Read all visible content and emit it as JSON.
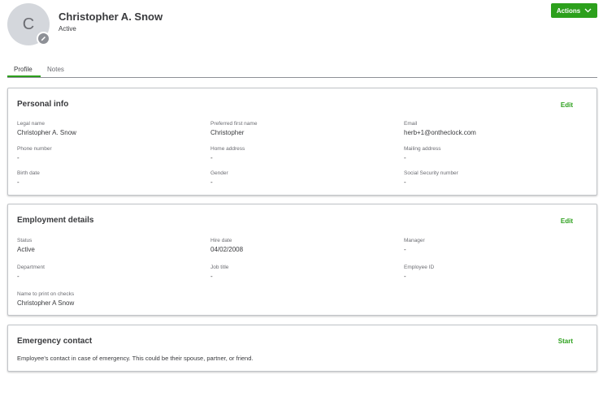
{
  "header": {
    "avatar_initial": "C",
    "name": "Christopher A. Snow",
    "status": "Active",
    "actions_label": "Actions"
  },
  "tabs": [
    {
      "label": "Profile",
      "active": true
    },
    {
      "label": "Notes",
      "active": false
    }
  ],
  "personal_info": {
    "title": "Personal info",
    "edit_label": "Edit",
    "fields": [
      {
        "label": "Legal name",
        "value": "Christopher A. Snow"
      },
      {
        "label": "Preferred first name",
        "value": "Christopher"
      },
      {
        "label": "Email",
        "value": "herb+1@ontheclock.com"
      },
      {
        "label": "Phone number",
        "value": "-"
      },
      {
        "label": "Home address",
        "value": "-"
      },
      {
        "label": "Mailing address",
        "value": "-"
      },
      {
        "label": "Birth date",
        "value": "-"
      },
      {
        "label": "Gender",
        "value": "-"
      },
      {
        "label": "Social Security number",
        "value": "-"
      }
    ]
  },
  "employment_details": {
    "title": "Employment details",
    "edit_label": "Edit",
    "fields": [
      {
        "label": "Status",
        "value": "Active"
      },
      {
        "label": "Hire date",
        "value": "04/02/2008"
      },
      {
        "label": "Manager",
        "value": "-"
      },
      {
        "label": "Department",
        "value": "-"
      },
      {
        "label": "Job title",
        "value": "-"
      },
      {
        "label": "Employee ID",
        "value": "-"
      },
      {
        "label": "Name to print on checks",
        "value": "Christopher A Snow"
      }
    ]
  },
  "emergency_contact": {
    "title": "Emergency contact",
    "start_label": "Start",
    "description": "Employee's contact in case of emergency. This could be their spouse, partner, or friend."
  },
  "colors": {
    "accent": "#2ca01c",
    "text": "#393a3d",
    "muted": "#6b6c72",
    "avatar_bg": "#d4d7dc"
  }
}
